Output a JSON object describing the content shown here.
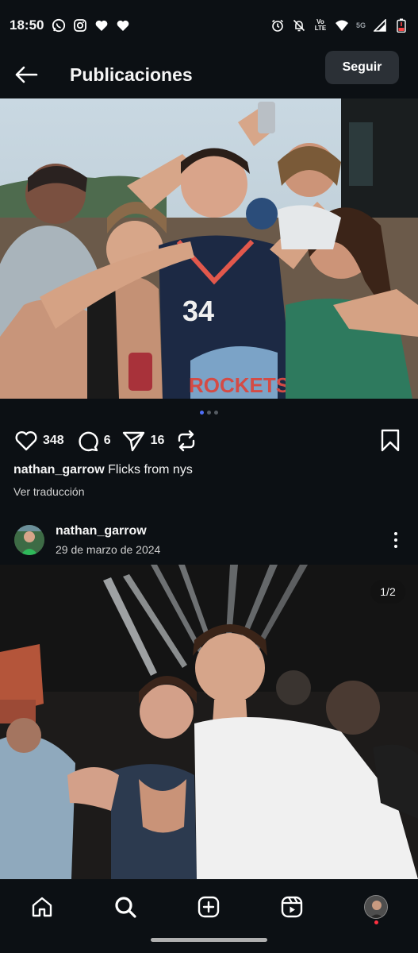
{
  "status_bar": {
    "time": "18:50",
    "left_icons": [
      "whatsapp-icon",
      "instagram-icon",
      "heart-icon",
      "heart-icon"
    ],
    "volte_text": "Vo\nLTE",
    "network": "5G",
    "right_icons": [
      "alarm-icon",
      "mute-icon",
      "wifi-icon",
      "signal-icon",
      "battery-low-icon"
    ]
  },
  "header": {
    "title": "Publicaciones",
    "follow_label": "Seguir"
  },
  "post1": {
    "carousel_total": 3,
    "carousel_index": 1,
    "likes": "348",
    "comments": "6",
    "shares": "16",
    "caption_user": "nathan_garrow",
    "caption_text": "Flicks from nys",
    "translate_label": "Ver traducción"
  },
  "post2": {
    "username": "nathan_garrow",
    "date": "29 de marzo de 2024",
    "counter": "1/2"
  },
  "bottom_nav": [
    "home-icon",
    "search-icon",
    "create-icon",
    "reels-icon",
    "profile-avatar"
  ],
  "colors": {
    "background": "#0c1014",
    "accent_dot": "#4f6ef7",
    "follow_button": "#2b3036",
    "notification_dot": "#ff3040"
  }
}
